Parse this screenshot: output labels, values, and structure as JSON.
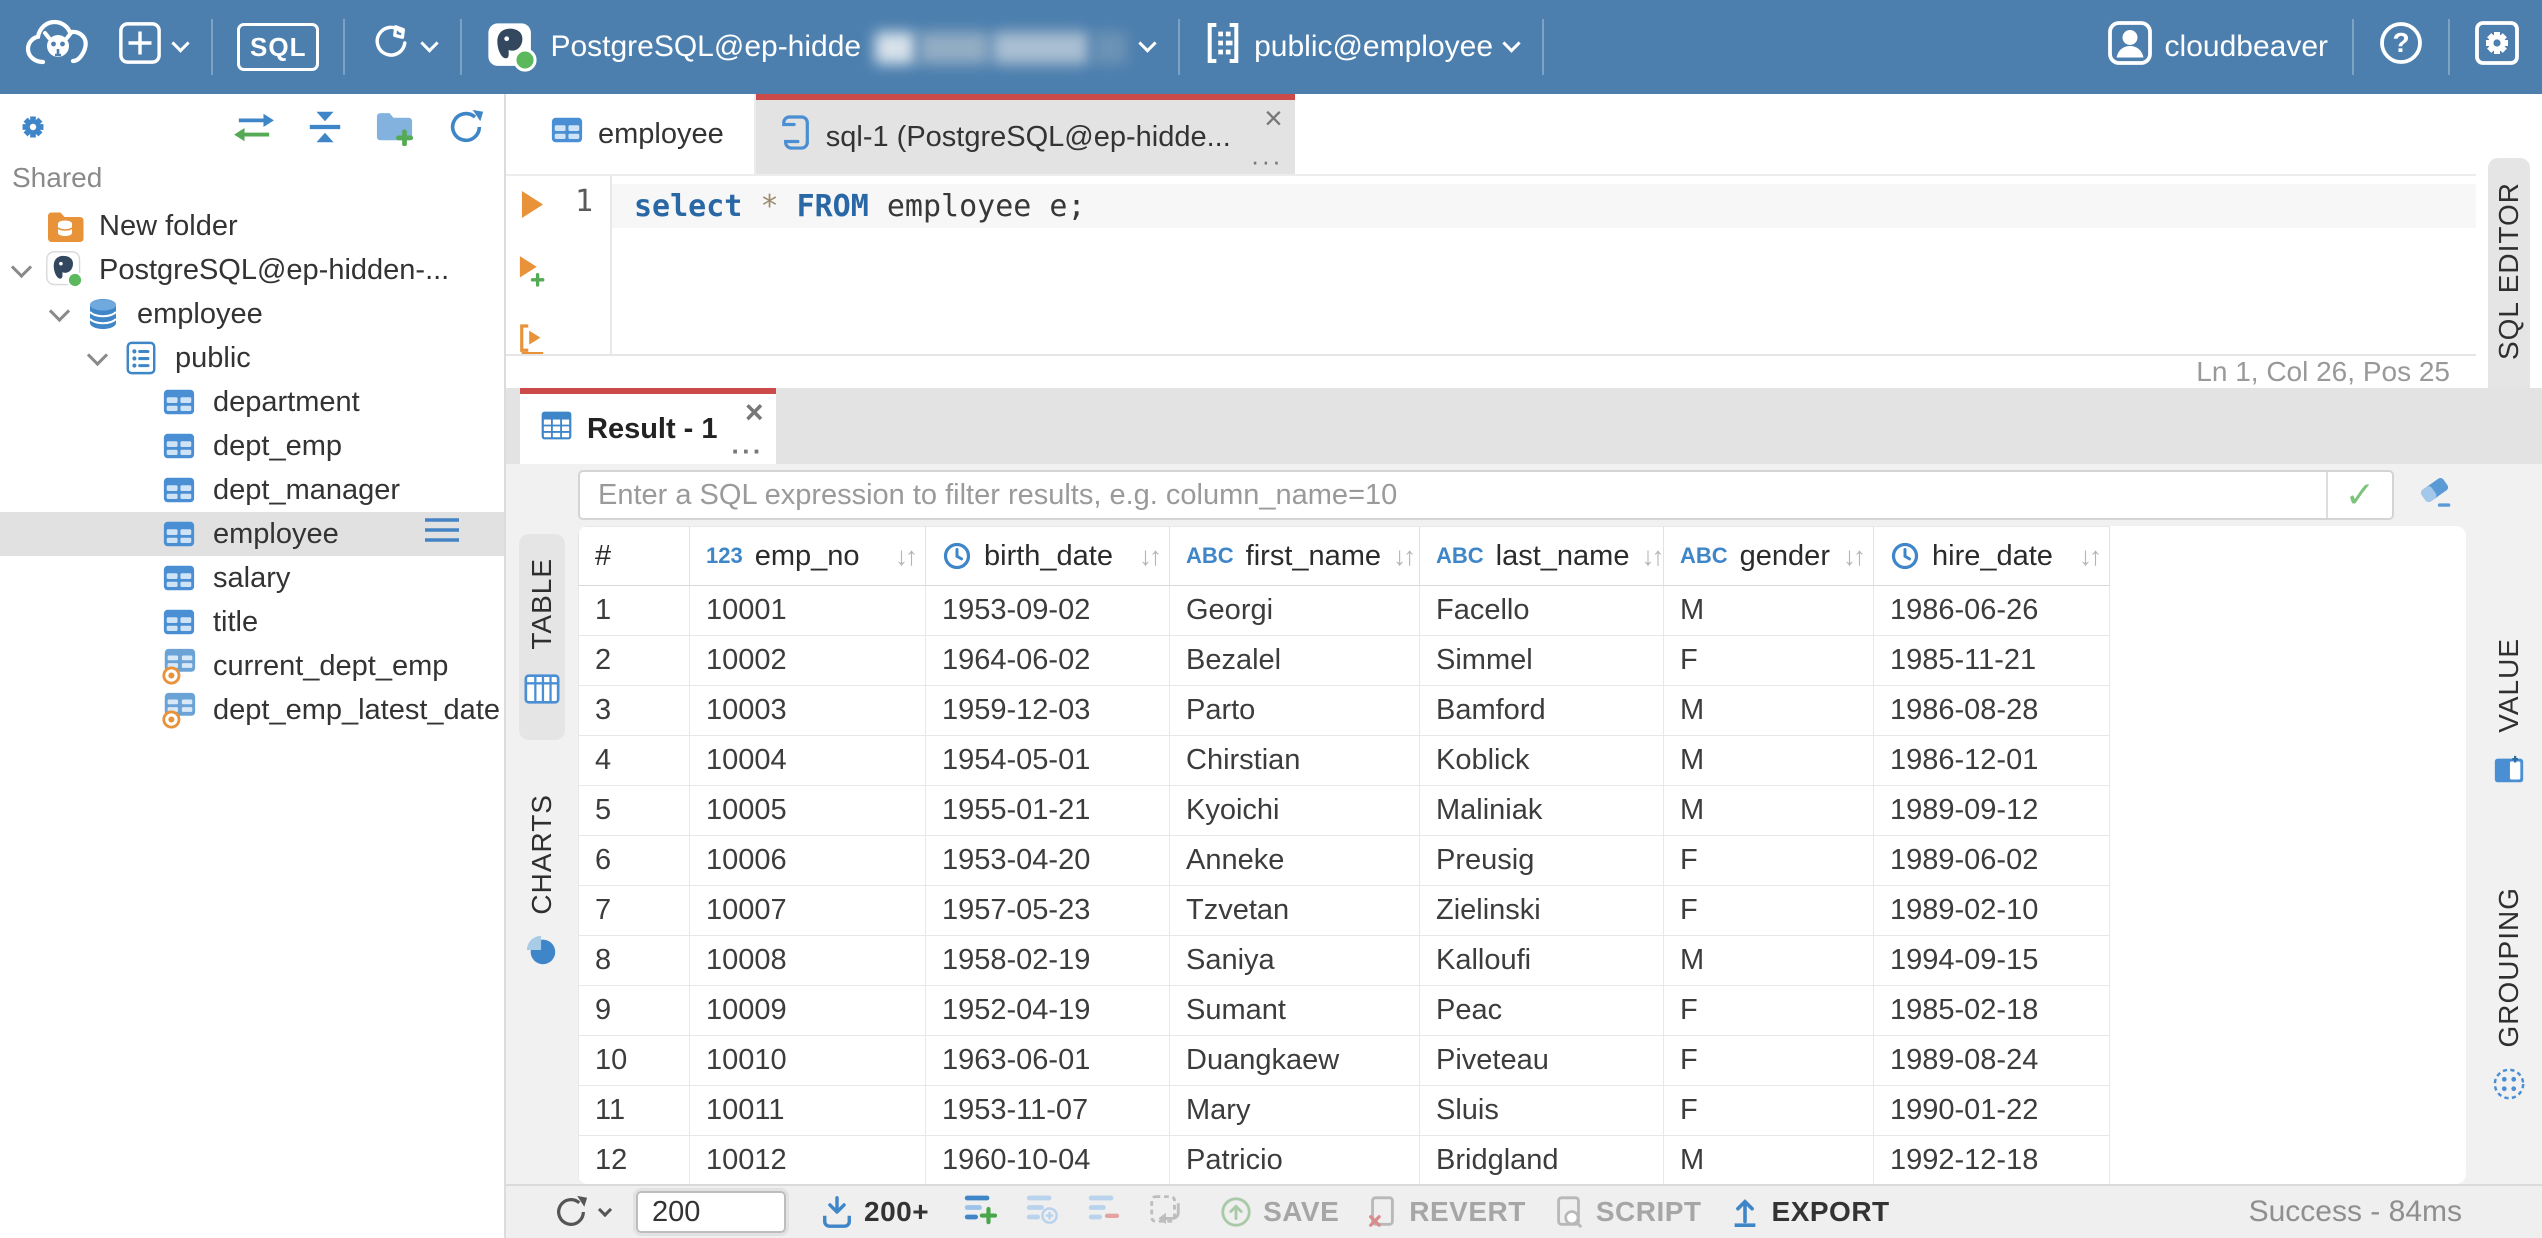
{
  "topbar": {
    "sql_badge": "SQL",
    "connection": {
      "label": "PostgreSQL@ep-hidde"
    },
    "schema": {
      "label": "public@employee"
    },
    "user": {
      "label": "cloudbeaver"
    }
  },
  "sidebar": {
    "shared_label": "Shared",
    "tree": [
      {
        "label": "New folder",
        "icon": "folder-db",
        "depth": 0,
        "chevron": false,
        "selected": false
      },
      {
        "label": "PostgreSQL@ep-hidden-...",
        "icon": "postgres",
        "depth": 0,
        "chevron": true,
        "selected": false
      },
      {
        "label": "employee",
        "icon": "database",
        "depth": 1,
        "chevron": true,
        "selected": false
      },
      {
        "label": "public",
        "icon": "schema",
        "depth": 2,
        "chevron": true,
        "selected": false
      },
      {
        "label": "department",
        "icon": "table",
        "depth": 3,
        "chevron": false,
        "selected": false
      },
      {
        "label": "dept_emp",
        "icon": "table",
        "depth": 3,
        "chevron": false,
        "selected": false
      },
      {
        "label": "dept_manager",
        "icon": "table",
        "depth": 3,
        "chevron": false,
        "selected": false
      },
      {
        "label": "employee",
        "icon": "table",
        "depth": 3,
        "chevron": false,
        "selected": true
      },
      {
        "label": "salary",
        "icon": "table",
        "depth": 3,
        "chevron": false,
        "selected": false
      },
      {
        "label": "title",
        "icon": "table",
        "depth": 3,
        "chevron": false,
        "selected": false
      },
      {
        "label": "current_dept_emp",
        "icon": "view",
        "depth": 3,
        "chevron": false,
        "selected": false
      },
      {
        "label": "dept_emp_latest_date",
        "icon": "view",
        "depth": 3,
        "chevron": false,
        "selected": false
      }
    ]
  },
  "editor": {
    "tabs": [
      {
        "label": "employee"
      },
      {
        "label": "sql-1 (PostgreSQL@ep-hidde..."
      }
    ],
    "line_number": "1",
    "sql_tokens": [
      {
        "text": "select",
        "type": "keyword"
      },
      {
        "text": " ",
        "type": "plain"
      },
      {
        "text": "*",
        "type": "star"
      },
      {
        "text": " ",
        "type": "plain"
      },
      {
        "text": "FROM",
        "type": "keyword"
      },
      {
        "text": " employee e;",
        "type": "plain"
      }
    ],
    "status": "Ln 1, Col 26, Pos 25",
    "vtab_label": "SQL EDITOR"
  },
  "result": {
    "tab_label": "Result - 1",
    "filter_placeholder": "Enter a SQL expression to filter results, e.g. column_name=10",
    "left_tabs": [
      {
        "label": "TABLE"
      },
      {
        "label": "CHARTS"
      }
    ],
    "right_tabs": [
      {
        "label": "VALUE"
      },
      {
        "label": "GROUPING"
      }
    ],
    "grid": {
      "columns": [
        {
          "name": "#",
          "type": "rownum"
        },
        {
          "name": "emp_no",
          "type": "number"
        },
        {
          "name": "birth_date",
          "type": "date"
        },
        {
          "name": "first_name",
          "type": "text"
        },
        {
          "name": "last_name",
          "type": "text"
        },
        {
          "name": "gender",
          "type": "text"
        },
        {
          "name": "hire_date",
          "type": "date"
        }
      ],
      "rows": [
        [
          "1",
          "10001",
          "1953-09-02",
          "Georgi",
          "Facello",
          "M",
          "1986-06-26"
        ],
        [
          "2",
          "10002",
          "1964-06-02",
          "Bezalel",
          "Simmel",
          "F",
          "1985-11-21"
        ],
        [
          "3",
          "10003",
          "1959-12-03",
          "Parto",
          "Bamford",
          "M",
          "1986-08-28"
        ],
        [
          "4",
          "10004",
          "1954-05-01",
          "Chirstian",
          "Koblick",
          "M",
          "1986-12-01"
        ],
        [
          "5",
          "10005",
          "1955-01-21",
          "Kyoichi",
          "Maliniak",
          "M",
          "1989-09-12"
        ],
        [
          "6",
          "10006",
          "1953-04-20",
          "Anneke",
          "Preusig",
          "F",
          "1989-06-02"
        ],
        [
          "7",
          "10007",
          "1957-05-23",
          "Tzvetan",
          "Zielinski",
          "F",
          "1989-02-10"
        ],
        [
          "8",
          "10008",
          "1958-02-19",
          "Saniya",
          "Kalloufi",
          "M",
          "1994-09-15"
        ],
        [
          "9",
          "10009",
          "1952-04-19",
          "Sumant",
          "Peac",
          "F",
          "1985-02-18"
        ],
        [
          "10",
          "10010",
          "1963-06-01",
          "Duangkaew",
          "Piveteau",
          "F",
          "1989-08-24"
        ],
        [
          "11",
          "10011",
          "1953-11-07",
          "Mary",
          "Sluis",
          "F",
          "1990-01-22"
        ],
        [
          "12",
          "10012",
          "1960-10-04",
          "Patricio",
          "Bridgland",
          "M",
          "1992-12-18"
        ]
      ]
    },
    "toolbar": {
      "row_limit_value": "200",
      "fetch_more_label": "200+",
      "save_label": "SAVE",
      "revert_label": "REVERT",
      "script_label": "SCRIPT",
      "export_label": "EXPORT",
      "status": "Success - 84ms"
    }
  },
  "colors": {
    "topbar": "#4d7fae",
    "accent_red": "#cb4a4a",
    "icon_blue": "#3f86c9",
    "success_green": "#7cc47c",
    "orange": "#e8923a"
  }
}
